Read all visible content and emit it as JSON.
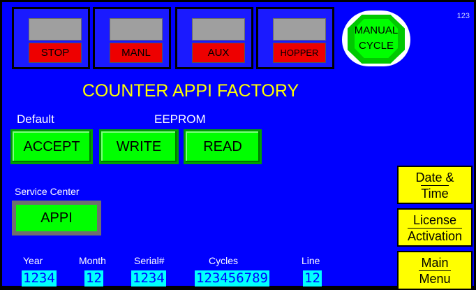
{
  "status_boxes": [
    {
      "label": "STOP"
    },
    {
      "label": "MANL"
    },
    {
      "label": "AUX"
    },
    {
      "label": "HOPPER"
    }
  ],
  "manual_cycle": {
    "line1": "MANUAL",
    "line2": "CYCLE"
  },
  "corner_number": "123",
  "title": "COUNTER APPI FACTORY",
  "labels": {
    "default": "Default",
    "eeprom": "EEPROM",
    "service_center": "Service Center"
  },
  "buttons": {
    "accept": "ACCEPT",
    "write": "WRITE",
    "read": "READ",
    "appi": "APPI"
  },
  "side_buttons": {
    "date_time": [
      "Date &",
      "Time"
    ],
    "license": [
      "License",
      "Activation"
    ],
    "main_menu": [
      "Main",
      "Menu"
    ]
  },
  "fields": [
    {
      "header": "Year",
      "value": "1234"
    },
    {
      "header": "Month",
      "value": "12"
    },
    {
      "header": "Serial#",
      "value": "1234"
    },
    {
      "header": "Cycles",
      "value": "123456789"
    },
    {
      "header": "Line",
      "value": "12"
    }
  ],
  "colors": {
    "background": "#0000ff",
    "title": "#ffff00",
    "button_green": "#00ff00",
    "tag_red": "#ee0000",
    "field_cyan": "#00ffff",
    "side_yellow": "#ffff00"
  }
}
